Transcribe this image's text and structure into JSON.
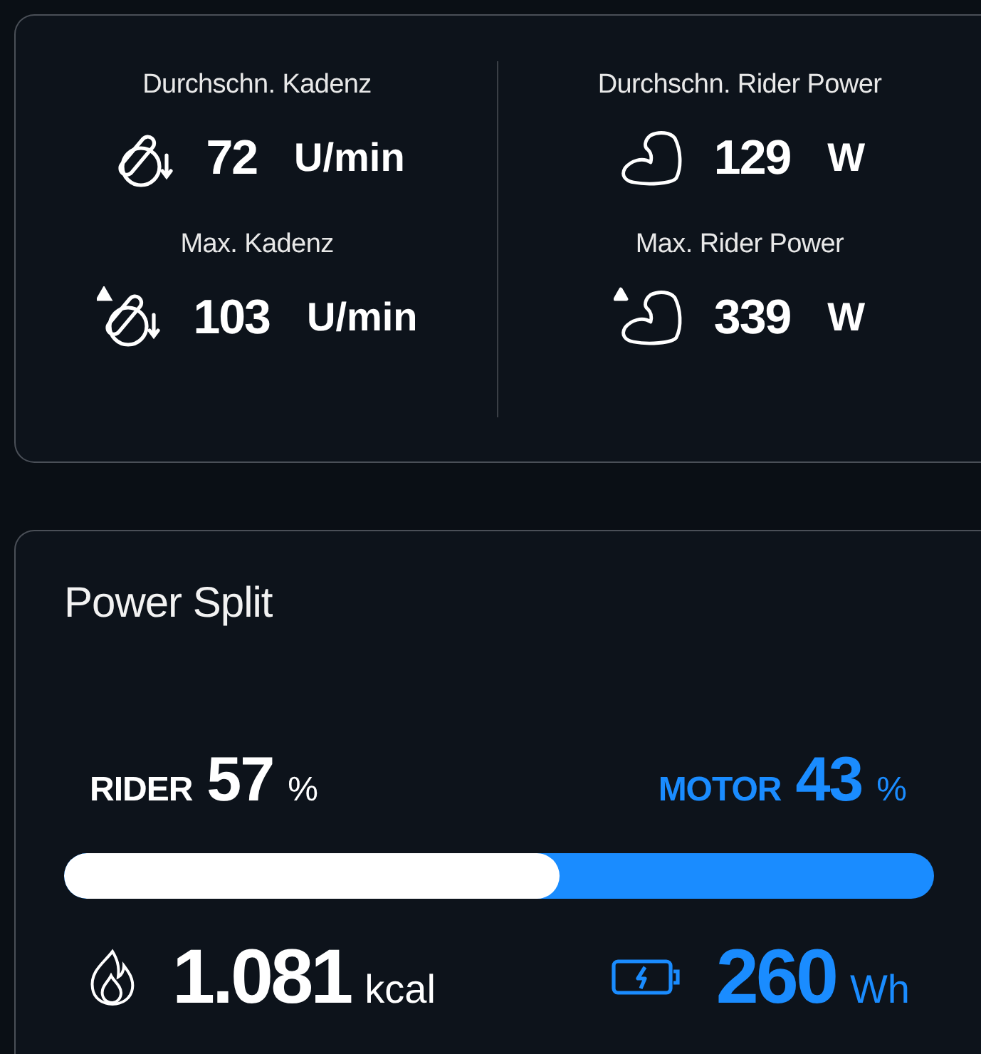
{
  "stats_card": {
    "columns": [
      {
        "items": [
          {
            "label": "Durchschn. Kadenz",
            "kind": "cadence",
            "max": false,
            "value": "72",
            "unit": "U/min"
          },
          {
            "label": "Max. Kadenz",
            "kind": "cadence",
            "max": true,
            "value": "103",
            "unit": "U/min"
          }
        ]
      },
      {
        "items": [
          {
            "label": "Durchschn. Rider Power",
            "kind": "power",
            "max": false,
            "value": "129",
            "unit": "W"
          },
          {
            "label": "Max. Rider Power",
            "kind": "power",
            "max": true,
            "value": "339",
            "unit": "W"
          }
        ]
      }
    ]
  },
  "power_split": {
    "title": "Power Split",
    "rider": {
      "label": "RIDER",
      "value": "57",
      "unit": "%"
    },
    "motor": {
      "label": "MOTOR",
      "value": "43",
      "unit": "%"
    },
    "bar": {
      "level": 0.57
    },
    "energy": {
      "value": "1.081",
      "unit": "kcal"
    },
    "battery": {
      "value": "260",
      "unit": "Wh"
    }
  }
}
